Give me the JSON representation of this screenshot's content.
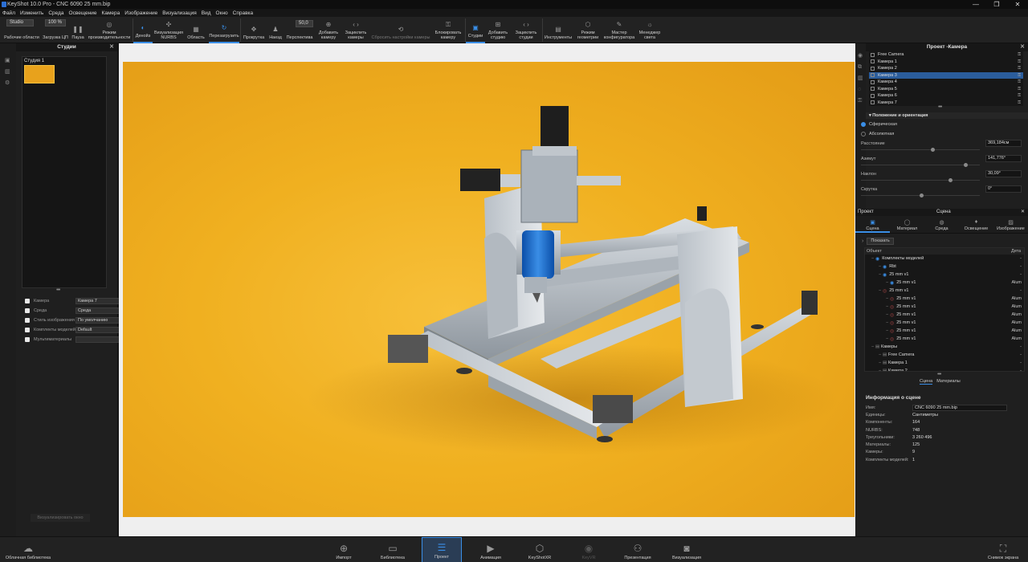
{
  "window": {
    "title": "KeyShot 10.0 Pro  -  CNC 6090 25 mm.bip",
    "controls": [
      "—",
      "❐",
      "✕"
    ]
  },
  "menu": [
    "Файл",
    "Изменить",
    "Среда",
    "Освещение",
    "Камера",
    "Изображение",
    "Визуализация",
    "Вид",
    "Окно",
    "Справка"
  ],
  "toolbar": {
    "workspace_value": "Studio",
    "workspace_label": "Рабочие области",
    "cpu_value": "100 %",
    "cpu_label": "Загрузка ЦП",
    "pause": "Пауза",
    "perf": "Режим производительности",
    "denoise": "Денойз",
    "nurbs": "Визуализация NURBS",
    "region": "Область",
    "reload": "Перезагрузить",
    "tumble": "Прокрутка",
    "dolly": "Наезд",
    "persp": "Перспектива",
    "persp_value": "50,0",
    "add_camera": "Добавить камеру",
    "lock_cameras": "Зациклить камеры",
    "reset_camera": "Сбросить настройки камеры",
    "lock_camera": "Блокировать камеру",
    "studio": "Студии",
    "add_studio": "Добавить студию",
    "cycle_studio": "Зациклить студии",
    "tools": "Инструменты",
    "geometry": "Режим геометрии",
    "wizard": "Мастер конфигуратора",
    "light_manager": "Менеджер света"
  },
  "left": {
    "header": "Студии",
    "studio_name": "Студия 1",
    "props": [
      {
        "label": "Камера",
        "value": "Камера 7"
      },
      {
        "label": "Среда",
        "value": "Среда"
      },
      {
        "label": "Стиль изображения",
        "value": "По умолчанию"
      },
      {
        "label": "Комплекты моделей",
        "value": "Default"
      },
      {
        "label": "Мультиматериалы",
        "value": ""
      }
    ],
    "render_window": "Визуализировать окно"
  },
  "right": {
    "header": "Проект -Камера",
    "cameras": [
      "Free Camera",
      "Камера 1",
      "Камера 2",
      "Камера 3",
      "Камера 4",
      "Камера 5",
      "Камера 6",
      "Камера 7"
    ],
    "section": "Положение и ориентация",
    "radio_spherical": "Сферическая",
    "radio_absolute": "Абсолютная",
    "fields": [
      {
        "label": "Расстояние",
        "value": "369,184см",
        "knob": 0.6
      },
      {
        "label": "Азимут",
        "value": "141,776°",
        "knob": 0.88
      },
      {
        "label": "Наклон",
        "value": "30,09°",
        "knob": 0.75
      },
      {
        "label": "Скрутка",
        "value": "0°",
        "knob": 0.5
      }
    ]
  },
  "scene": {
    "tab_project": "Проект",
    "tab_scene": "Сцена",
    "subtabs": [
      "Сцена",
      "Материал",
      "Среда",
      "Освещение",
      "Изображение"
    ],
    "show_btn": "Показать",
    "col_object": "Объект",
    "col_detail": "Дета",
    "rows": [
      {
        "name": "Комплекты моделей",
        "mat": "-",
        "eye": "on",
        "indent": 1
      },
      {
        "name": "Rbt",
        "mat": "-",
        "eye": "on",
        "indent": 2
      },
      {
        "name": "25 mm v1",
        "mat": "-",
        "eye": "on",
        "indent": 2
      },
      {
        "name": "25 mm v1",
        "mat": "Alum",
        "eye": "on",
        "indent": 3
      },
      {
        "name": "25 mm v1",
        "mat": "-",
        "eye": "off",
        "indent": 2
      },
      {
        "name": "25 mm v1",
        "mat": "Alum",
        "eye": "off",
        "indent": 3
      },
      {
        "name": "25 mm v1",
        "mat": "Alum",
        "eye": "off",
        "indent": 3
      },
      {
        "name": "25 mm v1",
        "mat": "Alum",
        "eye": "off",
        "indent": 3
      },
      {
        "name": "25 mm v1",
        "mat": "Alum",
        "eye": "off",
        "indent": 3
      },
      {
        "name": "25 mm v1",
        "mat": "Alum",
        "eye": "off",
        "indent": 3
      },
      {
        "name": "25 mm v1",
        "mat": "Alum",
        "eye": "off",
        "indent": 3
      },
      {
        "name": "Камеры",
        "mat": "-",
        "eye": "",
        "indent": 1
      },
      {
        "name": "Free Camera",
        "mat": "-",
        "eye": "",
        "indent": 2
      },
      {
        "name": "Камера 1",
        "mat": "-",
        "eye": "",
        "indent": 2
      },
      {
        "name": "Камера 2",
        "mat": "-",
        "eye": "",
        "indent": 2
      }
    ],
    "bottom_tabs": [
      "Сцена",
      "Материалы"
    ],
    "info_title": "Информация о сцене",
    "info": [
      {
        "k": "Имя:",
        "v": "CNC 6090 25 mm.bip"
      },
      {
        "k": "Единицы:",
        "v": "Сантиметры"
      },
      {
        "k": "Компоненты:",
        "v": "164"
      },
      {
        "k": "NURBS:",
        "v": "748"
      },
      {
        "k": "Треугольники:",
        "v": "3 260 496"
      },
      {
        "k": "Материалы:",
        "v": "125"
      },
      {
        "k": "Камеры:",
        "v": "9"
      },
      {
        "k": "Комплекты моделей:",
        "v": "1"
      }
    ]
  },
  "bottom": {
    "cloud": "Облачная библиотека",
    "import": "Импорт",
    "library": "Библиотека",
    "project": "Проект",
    "animation": "Анимация",
    "keyshotxr": "KeyShotXR",
    "keyvr": "KeyVR",
    "presentation": "Презентация",
    "render": "Визуализация",
    "screenshot": "Снимок экрана"
  },
  "colors": {
    "accent": "#3a8ee6",
    "backdrop": "#f0b020"
  }
}
